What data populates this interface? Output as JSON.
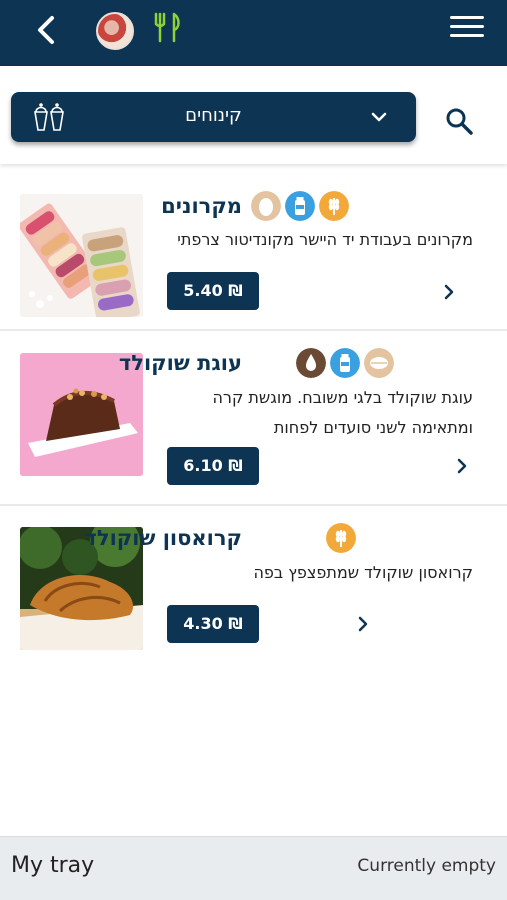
{
  "header": {
    "back_icon": "chevron-left-icon",
    "logo_icon": "restaurant-logo",
    "fork_icon": "fork-knife-icon",
    "menu_icon": "hamburger-menu-icon"
  },
  "filter": {
    "category_label": "קינוחים",
    "category_icon": "dessert-cups-icon",
    "dropdown_icon": "chevron-down-icon",
    "search_icon": "search-icon"
  },
  "items": [
    {
      "title": "מקרונים",
      "description_lines": [
        "מקרונים בעבודת יד היישר מקונדיטור צרפתי"
      ],
      "price": "5.40 ₪",
      "badges": [
        "wheat-icon",
        "milk-icon",
        "egg-icon"
      ]
    },
    {
      "title": "עוגת שוקולד",
      "description_lines": [
        "עוגת שוקולד בלגי משובח. מוגשת קרה",
        "ומתאימה לשני סועדים לפחות"
      ],
      "price": "6.10 ₪",
      "badges": [
        "nut-icon",
        "milk-icon",
        "drop-icon"
      ]
    },
    {
      "title": "קרואסון שוקולד",
      "description_lines": [
        "קרואסון שוקולד שמתפצפץ בפה"
      ],
      "price": "4.30 ₪",
      "badges": [
        "wheat-icon"
      ]
    }
  ],
  "colors": {
    "navy": "#0d3452",
    "orange_badge": "#f3a83a",
    "blue_badge": "#3aa0e0",
    "tan_badge": "#e3c3a0",
    "dark_badge": "#6a4a35"
  },
  "tray": {
    "label": "My tray",
    "status": "Currently empty"
  }
}
